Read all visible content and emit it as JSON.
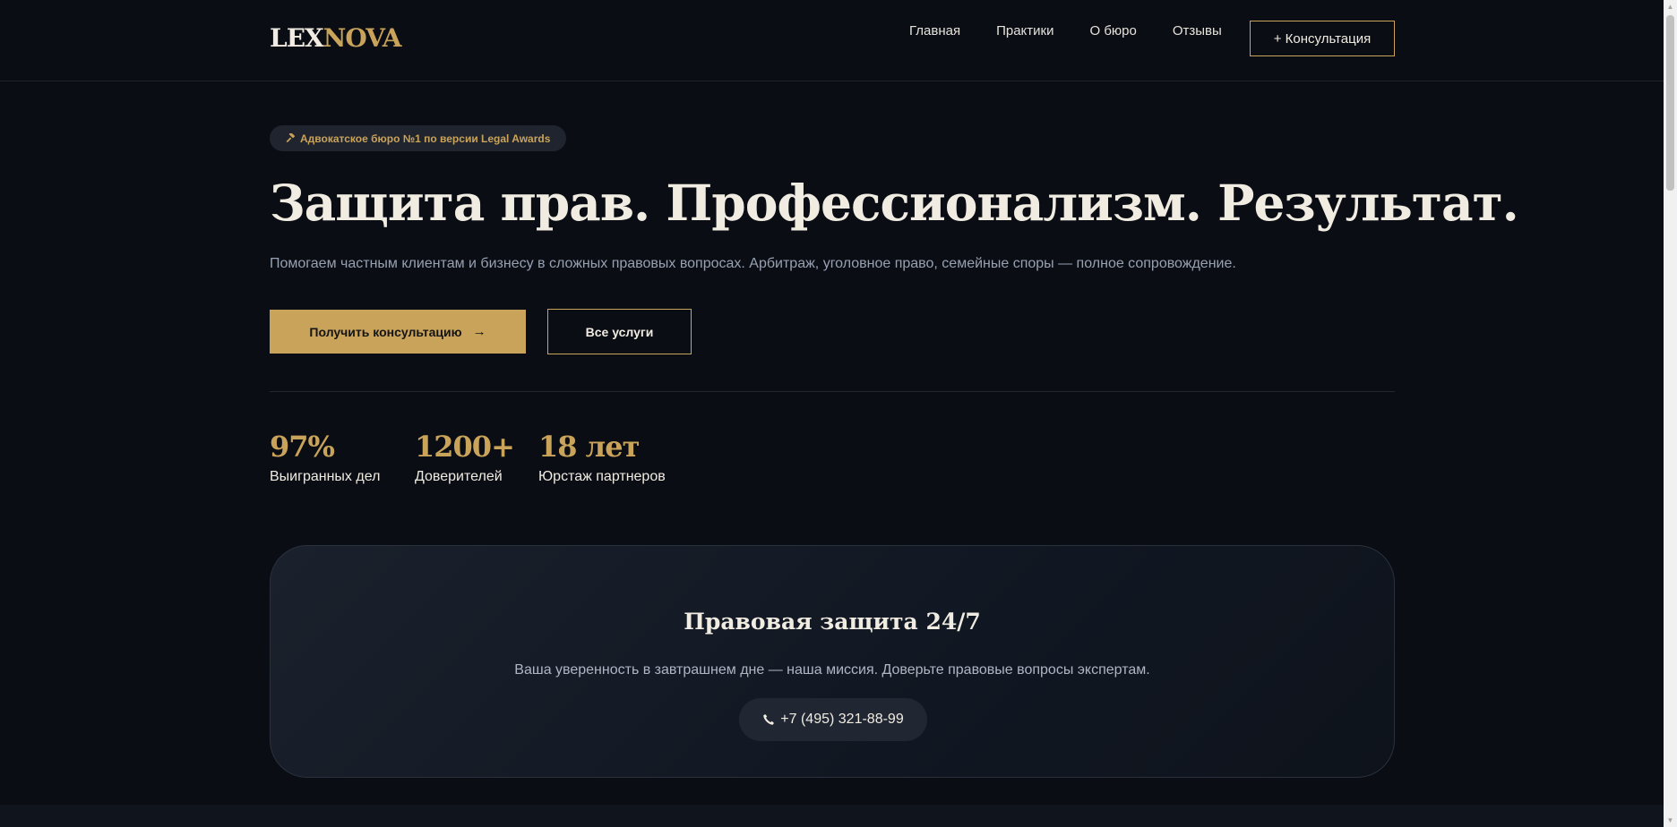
{
  "header": {
    "logo_part1": "LEX",
    "logo_part2": "NOVA",
    "nav": [
      "Главная",
      "Практики",
      "О бюро",
      "Отзывы"
    ],
    "cta": "+ Консультация"
  },
  "hero": {
    "badge_icon": "gavel-icon",
    "badge": "Адвокатское бюро №1 по версии Legal Awards",
    "title": "Защита прав. Профессионализм. Результат.",
    "subtitle": "Помогаем частным клиентам и бизнесу в сложных правовых вопросах. Арбитраж, уголовное право, семейные споры — полное сопровождение.",
    "primary_button": "Получить консультацию",
    "secondary_button": "Все услуги"
  },
  "stats": [
    {
      "value": "97%",
      "label": "Выигранных дел"
    },
    {
      "value": "1200+",
      "label": "Доверителей"
    },
    {
      "value": "18 лет",
      "label": "Юрстаж партнеров"
    }
  ],
  "card": {
    "title": "Правовая защита 24/7",
    "subtitle": "Ваша уверенность в завтрашнем дне — наша миссия. Доверьте правовые вопросы экспертам.",
    "phone_icon": "phone-icon",
    "phone": "+7 (495) 321-88-99"
  },
  "colors": {
    "background": "#0a0d14",
    "accent": "#c9a35a",
    "text": "#f1ece2"
  }
}
